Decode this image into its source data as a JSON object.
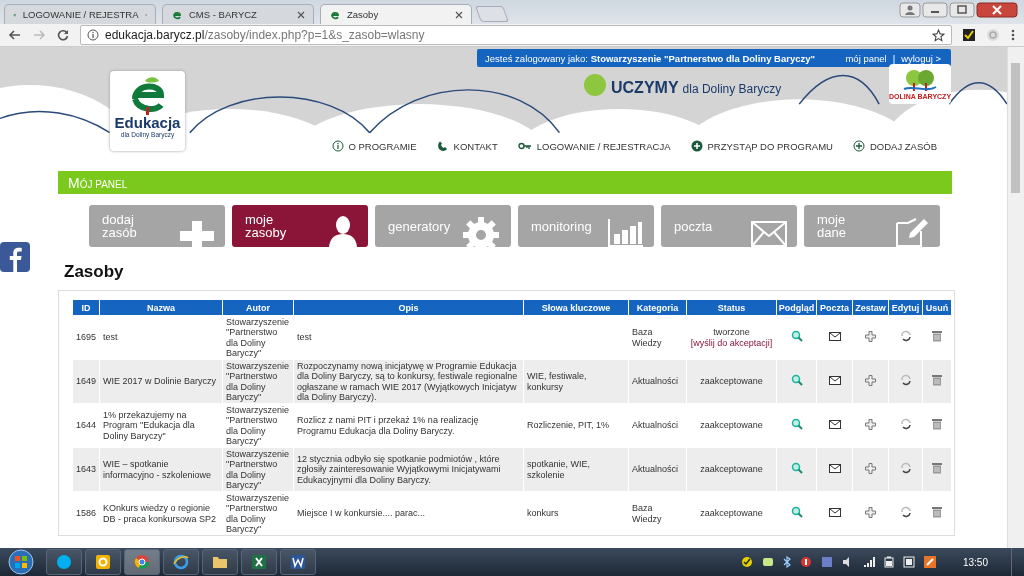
{
  "browser": {
    "tabs": [
      {
        "title": "LOGOWANIE / REJESTRA",
        "selected": false
      },
      {
        "title": "CMS - BARYCZ",
        "selected": false
      },
      {
        "title": "Zasoby",
        "selected": true
      }
    ],
    "url_host": "edukacja.barycz.pl",
    "url_path": "/zasoby/index.php?p=1&s_zasob=wlasny"
  },
  "login_bar": {
    "label": "Jesteś zalogowany jako:",
    "user": "Stowarzyszenie \"Partnerstwo dla Doliny Baryczy\"",
    "links": [
      "mój panel",
      "wyloguj >"
    ],
    "separator": "|"
  },
  "logo": {
    "name": "Edukacja",
    "sub": "dla Doliny Baryczy"
  },
  "banner": {
    "title": "UCZYMY",
    "sub": "dla Doliny Baryczy"
  },
  "right_logo": {
    "caption": "DOLINA BARYCZY"
  },
  "nav": [
    {
      "label": "O PROGRAMIE"
    },
    {
      "label": "KONTAKT"
    },
    {
      "label": "LOGOWANIE / REJESTRACJA"
    },
    {
      "label": "PRZYSTĄP DO PROGRAMU"
    },
    {
      "label": "DODAJ ZASÓB"
    }
  ],
  "panel_title": "MÓJ PANEL",
  "tiles": [
    {
      "lines": [
        "dodaj",
        "zasób"
      ],
      "selected": false
    },
    {
      "lines": [
        "moje",
        "zasoby"
      ],
      "selected": true
    },
    {
      "lines": [
        "generatory"
      ],
      "selected": false
    },
    {
      "lines": [
        "monitoring"
      ],
      "selected": false
    },
    {
      "lines": [
        "poczta"
      ],
      "selected": false
    },
    {
      "lines": [
        "moje",
        "dane"
      ],
      "selected": false
    }
  ],
  "heading": "Zasoby",
  "table": {
    "columns": [
      "ID",
      "Nazwa",
      "Autor",
      "Opis",
      "Słowa kluczowe",
      "Kategoria",
      "Status",
      "Podgląd",
      "Poczta",
      "Zestaw",
      "Edytuj",
      "Usuń"
    ],
    "rows": [
      {
        "id": "1695",
        "name": "test",
        "author": "Stowarzyszenie \"Partnerstwo dla Doliny Baryczy\"",
        "description": "test",
        "keywords": "",
        "category": "Baza Wiedzy",
        "status": "tworzone",
        "action": "[wyślij do akceptacji]"
      },
      {
        "id": "1649",
        "name": "WIE 2017 w Dolinie Baryczy",
        "author": "Stowarzyszenie \"Partnerstwo dla Doliny Baryczy\"",
        "description": "Rozpoczynamy nową inicjatywę w Programie Edukacja dla Doliny Baryczy, są to konkursy, festiwale regionalne ogłaszane w ramach WIE 2017 (Wyjątkowych Inicjatyw dla Doliny Baryczy).",
        "keywords": "WIE, festiwale, konkursy",
        "category": "Aktualności",
        "status": "zaakceptowane"
      },
      {
        "id": "1644",
        "name": "1% przekazujemy na Program \"Edukacja dla Doliny Baryczy\"",
        "author": "Stowarzyszenie \"Partnerstwo dla Doliny Baryczy\"",
        "description": "Rozlicz z nami PIT i przekaż 1% na realizację Programu Edukacja dla Doliny Baryczy.",
        "keywords": "Rozliczenie, PIT, 1%",
        "category": "Aktualności",
        "status": "zaakceptowane"
      },
      {
        "id": "1643",
        "name": "WIE – spotkanie informacyjno - szkoleniowe",
        "author": "Stowarzyszenie \"Partnerstwo dla Doliny Baryczy\"",
        "description": "12 stycznia odbyło się spotkanie podmiotów , które zgłosiły zainteresowanie Wyjątkowymi Inicjatywami Edukacyjnymi dla Doliny Baryczy.",
        "keywords": "spotkanie, WIE, szkolenie",
        "category": "Aktualności",
        "status": "zaakceptowane"
      },
      {
        "id": "1586",
        "name": "KOnkurs wiedzy o regionie DB - praca konkursowa SP2",
        "author": "Stowarzyszenie \"Partnerstwo dla Doliny Baryczy\"",
        "description": "Miejsce I w konkursie.... parac...",
        "keywords": "konkurs",
        "category": "Baza Wiedzy",
        "status": "zaakceptowane"
      }
    ]
  },
  "taskbar": {
    "time": "13:50"
  }
}
